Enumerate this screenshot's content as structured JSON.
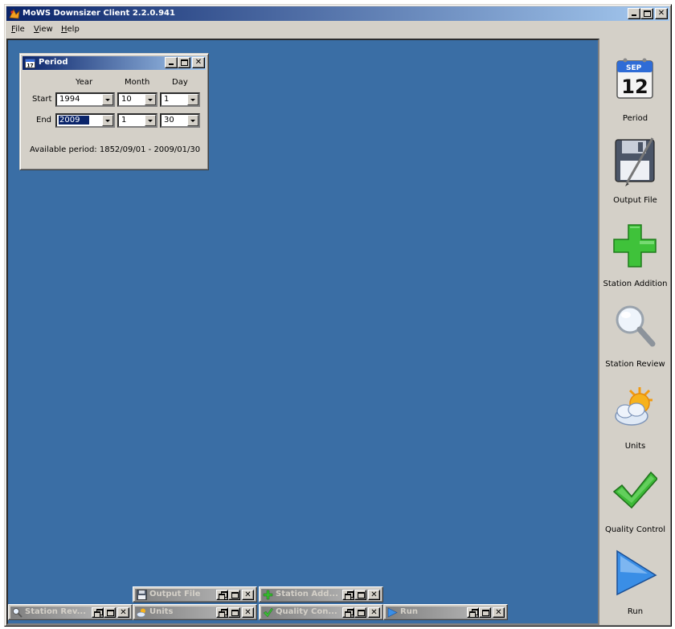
{
  "app": {
    "title": "MoWS Downsizer Client 2.2.0.941",
    "menu": [
      {
        "label": "File",
        "mnemonic": "F",
        "rest": "ile"
      },
      {
        "label": "View",
        "mnemonic": "V",
        "rest": "iew"
      },
      {
        "label": "Help",
        "mnemonic": "H",
        "rest": "elp"
      }
    ]
  },
  "period_window": {
    "title": "Period",
    "headers": {
      "year": "Year",
      "month": "Month",
      "day": "Day"
    },
    "start": {
      "label": "Start",
      "year": "1994",
      "month": "10",
      "day": "1"
    },
    "end": {
      "label": "End",
      "year": "2009",
      "month": "1",
      "day": "30"
    },
    "available": "Available period: 1852/09/01 - 2009/01/30"
  },
  "toolbar": {
    "items": [
      {
        "label": "Period",
        "icon": "calendar-icon",
        "calendar_month": "SEP",
        "calendar_day": "12"
      },
      {
        "label": "Output File",
        "icon": "floppy-disk-icon"
      },
      {
        "label": "Station Addition",
        "icon": "plus-icon"
      },
      {
        "label": "Station Review",
        "icon": "magnifier-icon"
      },
      {
        "label": "Units",
        "icon": "sun-cloud-icon"
      },
      {
        "label": "Quality Control",
        "icon": "checkmark-icon"
      },
      {
        "label": "Run",
        "icon": "play-icon"
      }
    ]
  },
  "minimized_windows": [
    {
      "title": "Output File",
      "icon": "floppy-disk-icon"
    },
    {
      "title": "Station Add...",
      "icon": "plus-icon"
    },
    {
      "title": "Station Rev...",
      "icon": "magnifier-icon"
    },
    {
      "title": "Units",
      "icon": "sun-cloud-icon"
    },
    {
      "title": "Quality Con...",
      "icon": "checkmark-icon"
    },
    {
      "title": "Run",
      "icon": "play-icon"
    }
  ],
  "colors": {
    "desktop": "#3a6ea5",
    "active_title_start": "#0a246a",
    "active_title_end": "#a6caf0",
    "face": "#d4d0c8"
  }
}
